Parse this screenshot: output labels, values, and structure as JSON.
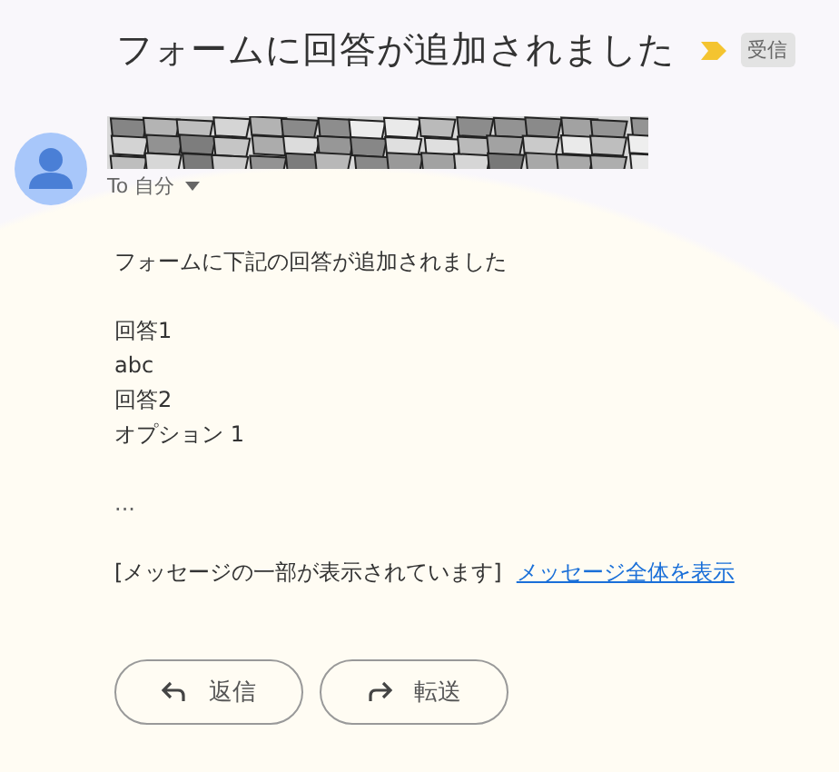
{
  "subject": "フォームに回答が追加されました",
  "important": true,
  "label": "受信",
  "recipient": "To 自分",
  "body": {
    "intro": "フォームに下記の回答が追加されました",
    "lines": [
      "回答1",
      "abc",
      "回答2",
      "オプション 1"
    ],
    "ellipsis": "...",
    "clipped_notice": "[メッセージの一部が表示されています]",
    "view_full_link": "メッセージ全体を表示"
  },
  "actions": [
    {
      "kind": "reply",
      "label": "返信"
    },
    {
      "kind": "forward",
      "label": "転送"
    }
  ]
}
